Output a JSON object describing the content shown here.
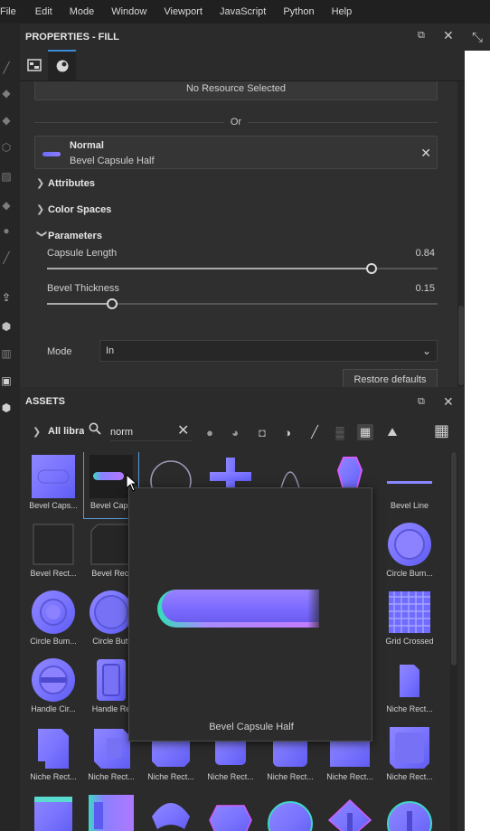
{
  "menubar": {
    "items": [
      "File",
      "Edit",
      "Mode",
      "Window",
      "Viewport",
      "JavaScript",
      "Python",
      "Help"
    ]
  },
  "properties": {
    "title": "PROPERTIES - FILL",
    "resource_placeholder": "No Resource Selected",
    "or_label": "Or",
    "selected_resource": {
      "channel": "Normal",
      "name": "Bevel Capsule Half"
    },
    "sections": {
      "attributes": "Attributes",
      "color_spaces": "Color Spaces",
      "parameters": "Parameters"
    },
    "params": {
      "capsule_length_label": "Capsule Length",
      "capsule_length_value": "0.84",
      "bevel_thickness_label": "Bevel Thickness",
      "bevel_thickness_value": "0.15",
      "mode_label": "Mode",
      "mode_value": "In"
    },
    "restore_label": "Restore defaults"
  },
  "assets": {
    "title": "ASSETS",
    "library_label": "All libraries",
    "search_value": "norm",
    "tiles": [
      "Bevel Caps...",
      "Bevel Caps",
      "",
      "",
      "",
      "",
      "Bevel Line",
      "Bevel Rect...",
      "Bevel Rect",
      "",
      "",
      "",
      "",
      "Circle Bum...",
      "Circle Bum...",
      "Circle Butt",
      "",
      "",
      "",
      "",
      "Grid Crossed",
      "Handle Cir...",
      "Handle Re",
      "",
      "",
      "",
      "",
      "Niche Rect...",
      "Niche Rect...",
      "Niche Rect...",
      "Niche Rect...",
      "Niche Rect...",
      "Niche Rect...",
      "Niche Rect...",
      "Niche Rect..."
    ],
    "preview_caption": "Bevel Capsule Half"
  },
  "colors": {
    "accent": "#3b8bd6",
    "normal_map_purple": "#7b78ff"
  }
}
